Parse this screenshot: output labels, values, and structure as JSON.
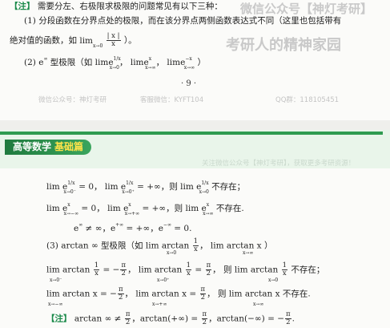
{
  "top_note": {
    "tag": "【注】",
    "text": "需要分左、右极限求极限的问题常见有以下三种："
  },
  "item1": {
    "line1": "(1) 分段函数在分界点处的极限，而在该分界点两侧函数表达式不同（这里也包括带有",
    "line2_a": "绝对值的函数，如",
    "line2_lim": "lim",
    "line2_sub": "x→0",
    "line2_num": "| x |",
    "line2_den": "x",
    "line2_b": "）。"
  },
  "item2": {
    "label": "(2) e",
    "sup": "∞",
    "text_a": "型极限（如",
    "lim1": "lim",
    "lim1_sub": "x→0",
    "lim1_body": "e",
    "lim1_sup": "1/x",
    "lim2": "lim",
    "lim2_sub": "x→∞",
    "lim2_body": "e",
    "lim2_sup": "x",
    "lim3": "lim",
    "lim3_sub": "x→∞",
    "lim3_body": "e",
    "lim3_sup": "−x",
    "text_b": "）"
  },
  "page_number": "· 9 ·",
  "watermarks": {
    "top_right": "微信公众号【神灯考研】",
    "top_right_2": "考研人的精神家园",
    "footer": [
      "微信公众号：神灯考研",
      "客服微信：KYFT104",
      "QQ群：118105451"
    ],
    "header_note": "关注微信公众号【神灯考研】，获取更多考研资源！"
  },
  "header": {
    "title_a": "高等数学",
    "title_b": "基础篇"
  },
  "eq1": {
    "a": "lim e",
    "a_sub": "x→0⁻",
    "a_sup": "1/x",
    "a_val": " = 0，",
    "b": "lim e",
    "b_sub": "x→0⁺",
    "b_sup": "1/x",
    "b_val": " = +∞，则",
    "c": "lim e",
    "c_sub": "x→0",
    "c_sup": "1/x",
    "c_val": " 不存在；"
  },
  "eq2": {
    "a": "lim e",
    "a_sub": "x→−∞",
    "a_sup": "x",
    "a_val": " = 0，",
    "b": "lim e",
    "b_sub": "x→+∞",
    "b_sup": "x",
    "b_val": " = +∞，则",
    "c": "lim e",
    "c_sub": "x→∞",
    "c_sup": "x",
    "c_val": " 不存在."
  },
  "eq3": {
    "text": "e",
    "sup": "∞",
    "rest": " ≠ ∞，e",
    "sup2": "+∞",
    "rest2": " = +∞，e",
    "sup3": "−∞",
    "rest3": " = 0."
  },
  "item3": {
    "label": "(3) arctan ∞ 型极限（如",
    "lim1": "lim arctan",
    "lim1_sub": "x→0",
    "num": "1",
    "den": "x",
    "mid": "，",
    "lim2": "lim arctan x",
    "lim2_sub": "x→∞",
    "end": "）"
  },
  "eq4": {
    "a": "lim arctan",
    "a_sub": "x→0⁻",
    "a_eq": " = −",
    "b": "lim arctan",
    "b_sub": "x→0⁺",
    "b_eq": " = ",
    "c": "则 lim arctan",
    "c_sub": "x→0",
    "c_end": " 不存在；",
    "pi": "π",
    "two": "2",
    "one": "1",
    "x": "x"
  },
  "eq5": {
    "a": "lim arctan x = −",
    "a_sub": "x→−∞",
    "b": "lim arctan x = ",
    "b_sub": "x→+∞",
    "c": "则 lim arctan x 不存在.",
    "c_sub": "x→∞"
  },
  "bottom_note": {
    "tag": "【注】",
    "text_a": "arctan ∞ ≠ ",
    "text_b": "，arctan(+∞) = ",
    "text_c": "，arctan(−∞) = −",
    "text_d": "."
  }
}
